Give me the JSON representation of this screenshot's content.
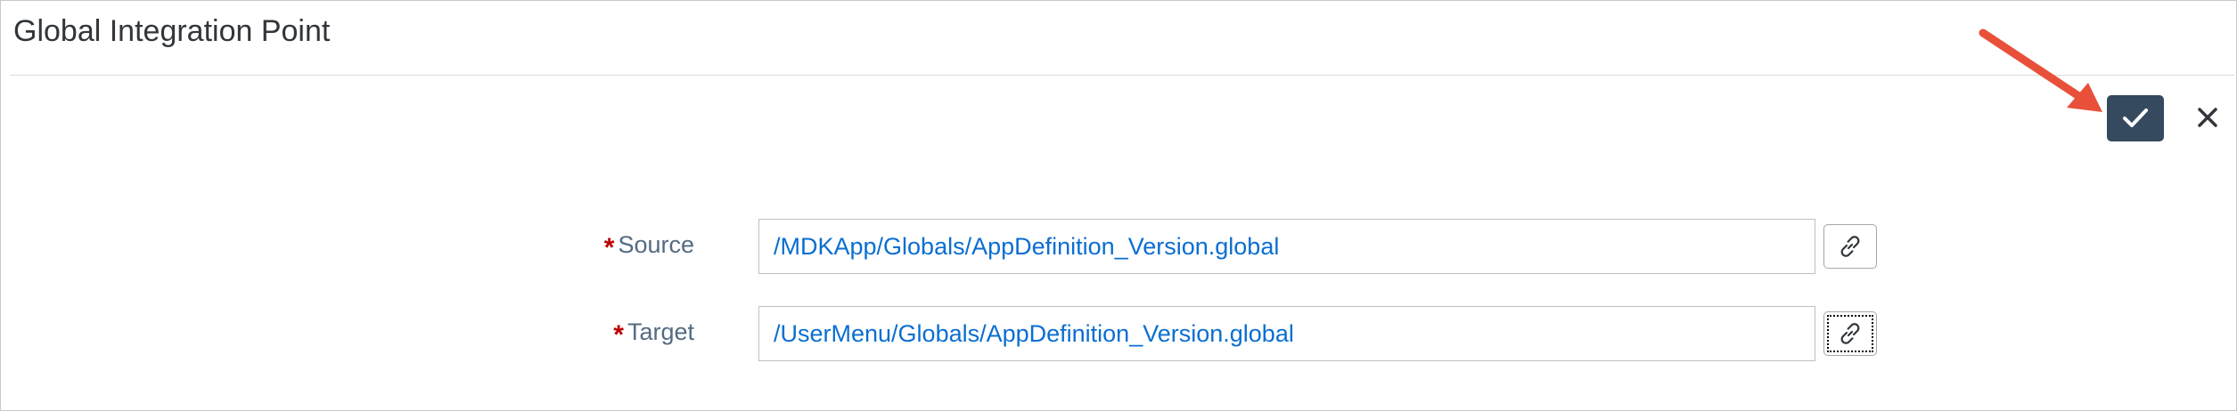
{
  "dialog": {
    "title": "Global Integration Point"
  },
  "toolbar": {
    "confirm_icon": "checkmark-icon",
    "close_icon": "close-icon",
    "accent_color": "#354a5f",
    "annotation_color": "#e8503a"
  },
  "form": {
    "source": {
      "label": "Source",
      "required_marker": "*",
      "value": "/MDKApp/Globals/AppDefinition_Version.global",
      "link_icon": "link-icon"
    },
    "target": {
      "label": "Target",
      "required_marker": "*",
      "value": "/UserMenu/Globals/AppDefinition_Version.global",
      "link_icon": "link-icon"
    }
  }
}
